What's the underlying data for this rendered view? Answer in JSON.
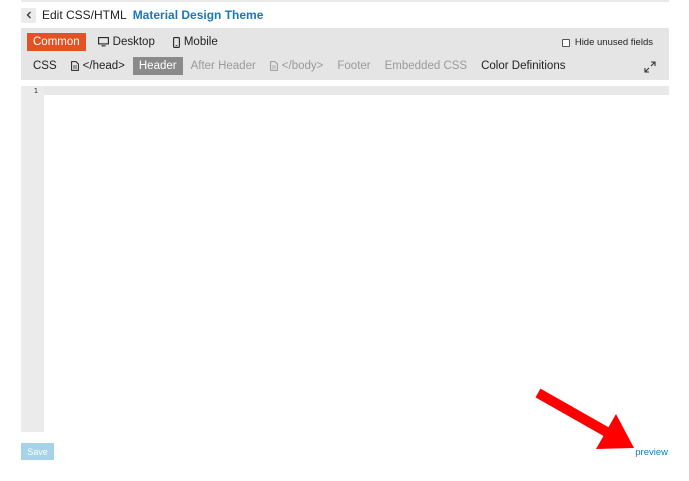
{
  "header": {
    "back_icon": "chevron-left-icon",
    "title_prefix": "Edit CSS/HTML",
    "title_theme": "Material Design Theme"
  },
  "device_tabs": [
    {
      "label": "Common",
      "icon": "",
      "state": "active"
    },
    {
      "label": "Desktop",
      "icon": "monitor-icon",
      "state": "normal"
    },
    {
      "label": "Mobile",
      "icon": "phone-icon",
      "state": "normal"
    }
  ],
  "hide_unused": {
    "label": "Hide unused fields",
    "checked": false
  },
  "section_tabs": [
    {
      "label": "CSS",
      "icon": "",
      "state": "normal"
    },
    {
      "label": "</head>",
      "icon": "file-icon",
      "state": "normal"
    },
    {
      "label": "Header",
      "icon": "",
      "state": "active"
    },
    {
      "label": "After Header",
      "icon": "",
      "state": "disabled"
    },
    {
      "label": "</body>",
      "icon": "file-icon",
      "state": "disabled"
    },
    {
      "label": "Footer",
      "icon": "",
      "state": "disabled"
    },
    {
      "label": "Embedded CSS",
      "icon": "",
      "state": "disabled"
    },
    {
      "label": "Color Definitions",
      "icon": "",
      "state": "normal"
    }
  ],
  "expand_icon": "expand-icon",
  "editor": {
    "line_numbers": [
      "1"
    ]
  },
  "footer": {
    "save_label": "Save",
    "preview_label": "preview"
  },
  "colors": {
    "accent_red": "#e55025",
    "link_blue": "#1b78b7",
    "save_disabled": "#a6d2ea",
    "annotation_arrow": "#ff0000"
  }
}
